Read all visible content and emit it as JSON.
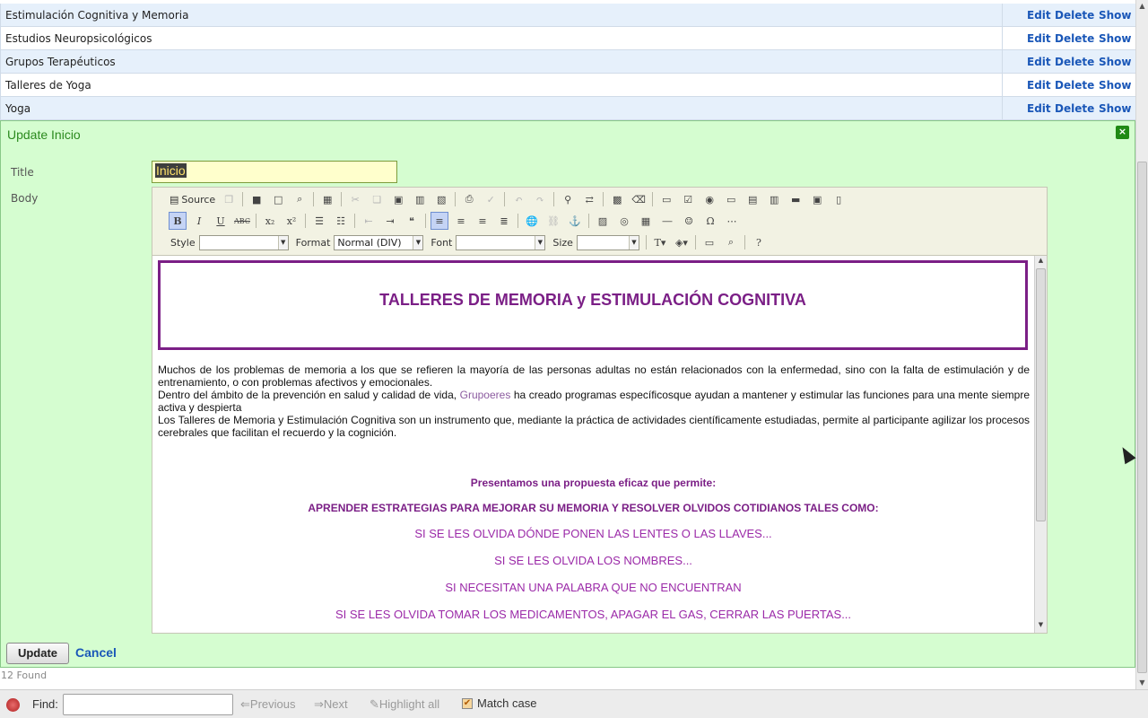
{
  "records": [
    {
      "name": "Estimulación Cognitiva y Memoria",
      "edit": "Edit",
      "delete": "Delete",
      "show": "Show"
    },
    {
      "name": "Estudios Neuropsicológicos",
      "edit": "Edit",
      "delete": "Delete",
      "show": "Show"
    },
    {
      "name": "Grupos Terapéuticos",
      "edit": "Edit",
      "delete": "Delete",
      "show": "Show"
    },
    {
      "name": "Talleres de Yoga",
      "edit": "Edit",
      "delete": "Delete",
      "show": "Show"
    },
    {
      "name": "Yoga",
      "edit": "Edit",
      "delete": "Delete",
      "show": "Show"
    }
  ],
  "panel": {
    "title": "Update Inicio",
    "close": "×",
    "title_label": "Title",
    "title_value": "Inicio",
    "body_label": "Body",
    "update_button": "Update",
    "cancel_link": "Cancel"
  },
  "editor": {
    "toolbar": {
      "source": "Source",
      "style_label": "Style",
      "style_value": "",
      "format_label": "Format",
      "format_value": "Normal (DIV)",
      "font_label": "Font",
      "font_value": "",
      "size_label": "Size",
      "size_value": ""
    },
    "content": {
      "banner_title": "TALLERES DE MEMORIA y ESTIMULACIÓN COGNITIVA",
      "p1": "Muchos de los problemas de memoria a los que se refieren la mayoría de las personas adultas no están relacionados con la enfermedad, sino con la falta de estimulación y de entrenamiento, o con problemas afectivos y emocionales.",
      "p2_before": "Dentro del ámbito de la prevención en salud y calidad de vida, ",
      "p2_link": "Grupoeres",
      "p2_after": " ha creado programas específicosque ayudan a mantener y estimular las funciones para una mente siempre activa y despierta",
      "p3": "Los Talleres de Memoria y Estimulación Cognitiva son un instrumento que, mediante la práctica de actividades científicamente estudiadas, permite al participante agilizar los procesos cerebrales que facilitan el recuerdo y la cognición.",
      "h1": "Presentamos una propuesta eficaz que permite:",
      "h2": "APRENDER  ESTRATEGIAS PARA MEJORAR SU MEMORIA Y RESOLVER  OLVIDOS COTIDIANOS TALES COMO:",
      "l1": "SI SE LES OLVIDA DÓNDE PONEN LAS LENTES O LAS LLAVES...",
      "l2": "SI SE LES OLVIDA LOS NOMBRES...",
      "l3": "SI NECESITAN UNA PALABRA QUE NO ENCUENTRAN",
      "l4": "SI SE LES OLVIDA TOMAR LOS MEDICAMENTOS, APAGAR EL GAS, CERRAR LAS PUERTAS..."
    }
  },
  "found": "12 Found",
  "findbar": {
    "find_label": "Find:",
    "find_value": "",
    "previous": "Previous",
    "next": "Next",
    "highlight_all": "Highlight all",
    "match_case": "Match case",
    "match_case_checked": true
  },
  "colors": {
    "accent_purple": "#7b1f86",
    "panel_green": "#d5fdd0",
    "link_blue": "#1a57b8",
    "row_alt": "#e6f0fb"
  }
}
